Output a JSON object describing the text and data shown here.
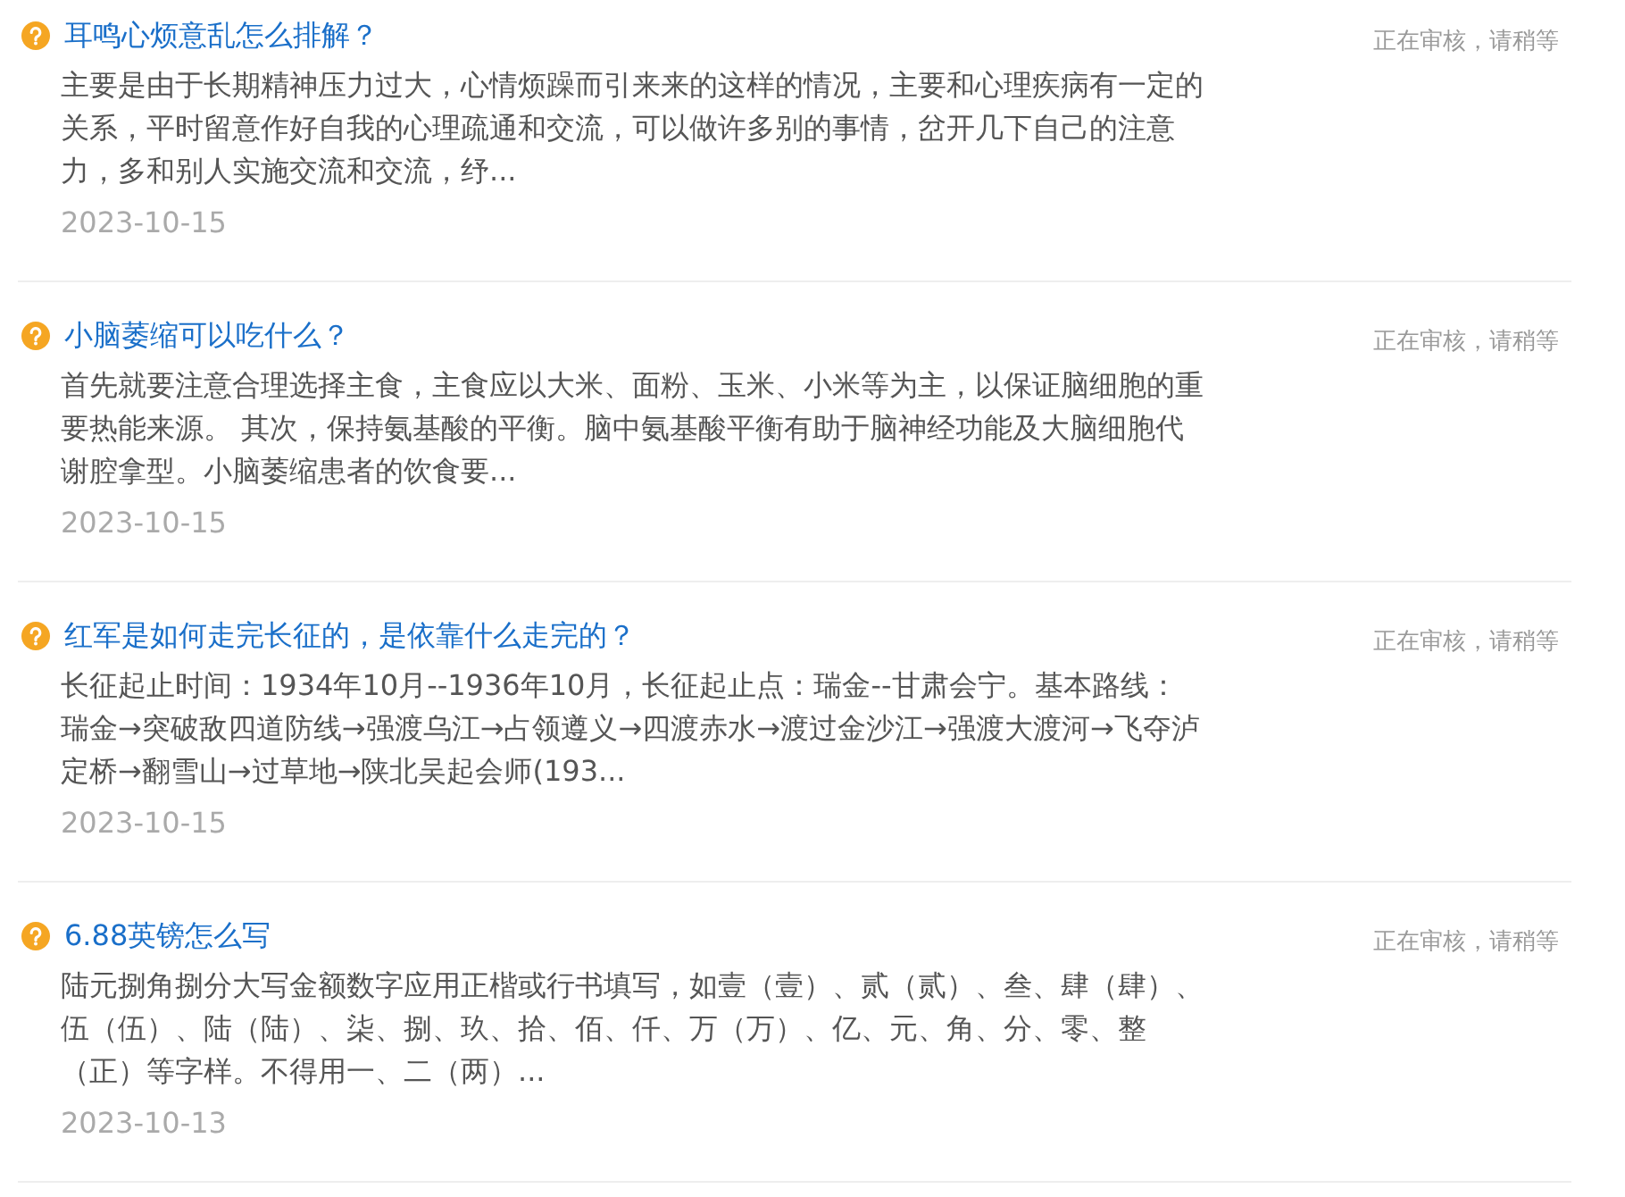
{
  "questions": [
    {
      "title": "耳鸣心烦意乱怎么排解？",
      "summary": "主要是由于长期精神压力过大，心情烦躁而引来来的这样的情况，主要和心理疾病有一定的关系，平时留意作好自我的心理疏通和交流，可以做许多别的事情，岔开几下自己的注意力，多和别人实施交流和交流，纾...",
      "date": "2023-10-15",
      "status": "正在审核，请稍等"
    },
    {
      "title": "小脑萎缩可以吃什么？",
      "summary": "首先就要注意合理选择主食，主食应以大米、面粉、玉米、小米等为主，以保证脑细胞的重要热能来源。 其次，保持氨基酸的平衡。脑中氨基酸平衡有助于脑神经功能及大脑细胞代谢腔拿型。小脑萎缩患者的饮食要...",
      "date": "2023-10-15",
      "status": "正在审核，请稍等"
    },
    {
      "title": "红军是如何走完长征的，是依靠什么走完的？",
      "summary": "长征起止时间：1934年10月--1936年10月，长征起止点：瑞金--甘肃会宁。基本路线：瑞金→突破敌四道防线→强渡乌江→占领遵义→四渡赤水→渡过金沙江→强渡大渡河→飞夺泸定桥→翻雪山→过草地→陕北吴起会师(193...",
      "date": "2023-10-15",
      "status": "正在审核，请稍等"
    },
    {
      "title": "6.88英镑怎么写",
      "summary": "陆元捌角捌分大写金额数字应用正楷或行书填写，如壹（壹）、贰（贰）、叁、肆（肆）、伍（伍）、陆（陆）、柒、捌、玖、拾、佰、仟、万（万）、亿、元、角、分、零、整（正）等字样。不得用一、二（两）...",
      "date": "2023-10-13",
      "status": "正在审核，请稍等"
    }
  ]
}
